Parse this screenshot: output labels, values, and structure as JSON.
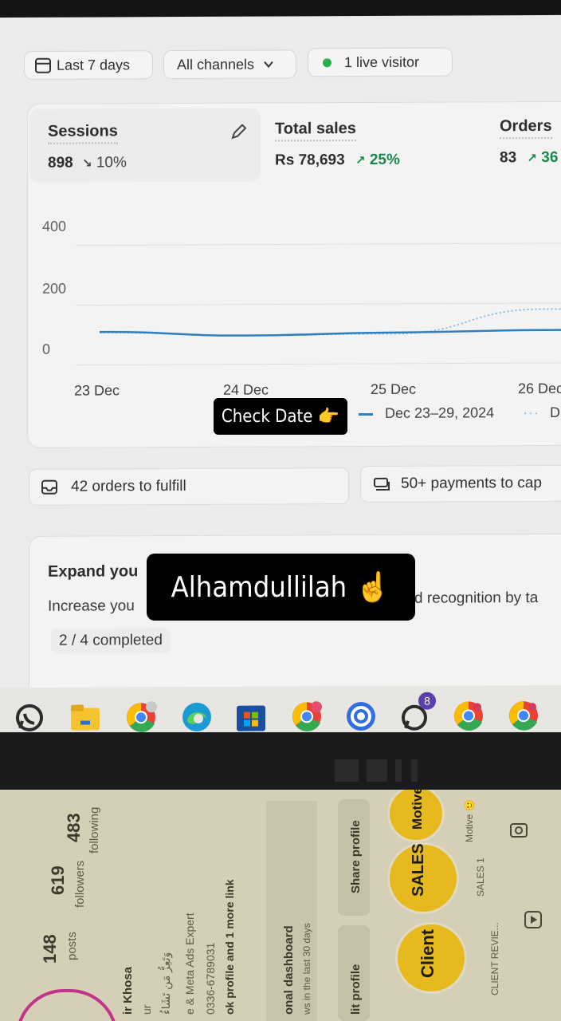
{
  "filters": {
    "date_range": "Last 7 days",
    "channels": "All channels",
    "live_visitors": "1 live visitor"
  },
  "metrics": {
    "sessions": {
      "label": "Sessions",
      "value": "898",
      "change": "10%"
    },
    "total_sales": {
      "label": "Total sales",
      "value": "Rs 78,693",
      "change": "25%"
    },
    "orders": {
      "label": "Orders",
      "value": "83",
      "change": "36"
    }
  },
  "chart_data": {
    "type": "line",
    "x": [
      "23 Dec",
      "24 Dec",
      "25 Dec",
      "26 Dec"
    ],
    "yticks": [
      "400",
      "200",
      "0"
    ],
    "ylim": [
      0,
      400
    ],
    "series": [
      {
        "name": "Dec 23–29, 2024",
        "values": [
          110,
          96,
          104,
          110
        ],
        "style": "solid",
        "color": "#2f7fc0"
      },
      {
        "name": "D",
        "values": [
          108,
          96,
          100,
          180
        ],
        "style": "dotted",
        "color": "#8fb8df"
      }
    ],
    "legend_placement": "bottom"
  },
  "legend": {
    "current": "Dec 23–29, 2024",
    "previous": "D"
  },
  "tasks": {
    "fulfill": "42 orders to fulfill",
    "payments": "50+ payments to cap"
  },
  "setup": {
    "title": "Expand you",
    "desc_left": "Increase you",
    "desc_right": "d recognition by ta",
    "progress": "2 / 4 completed"
  },
  "overlays": {
    "check_date": "Check Date 👉",
    "alhamdulillah": "Alhamdullilah ☝️"
  },
  "taskbar": {
    "whatsapp_badge": "8"
  },
  "instagram": {
    "posts_count": "148",
    "posts_label": "posts",
    "followers_count": "619",
    "followers_label": "followers",
    "following_count": "483",
    "following_label": "following",
    "name_fragment": "ir Khosa",
    "name_fragment2": "ur",
    "arabic_line": "وَتَعِزُّ مَن تَشَاءُ",
    "bio_line": "e & Meta Ads Expert",
    "phone": "0336-6789031",
    "links": "ok profile and 1 more link",
    "dashboard_title": "onal dashboard",
    "dashboard_sub": "ws in the last 30 days",
    "edit_profile": "lit profile",
    "share_profile": "Share profile",
    "highlights": [
      {
        "label": "CLIENT REVIE...",
        "logo": "Client"
      },
      {
        "label": "SALES 1",
        "logo": "SALES"
      },
      {
        "label": "Motive 🙂",
        "logo": "Motive"
      }
    ]
  }
}
